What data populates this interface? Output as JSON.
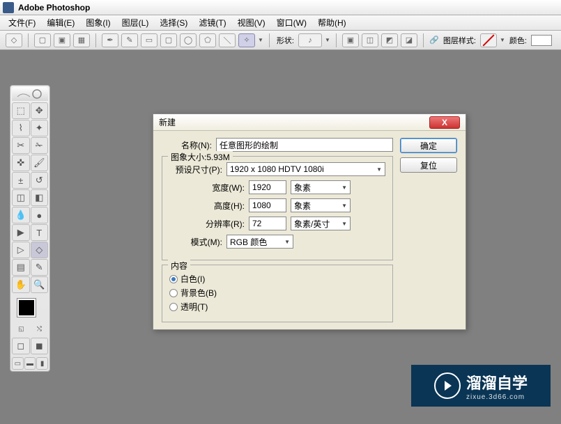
{
  "app": {
    "title": "Adobe Photoshop"
  },
  "menus": [
    "文件(F)",
    "编辑(E)",
    "图象(I)",
    "图层(L)",
    "选择(S)",
    "滤镜(T)",
    "视图(V)",
    "窗口(W)",
    "帮助(H)"
  ],
  "optionbar": {
    "shape_label": "形状:",
    "layer_style_label": "图层样式:",
    "color_label": "颜色:"
  },
  "dialog": {
    "title": "新建",
    "ok": "确定",
    "reset": "复位",
    "name_label": "名称(N):",
    "name_value": "任意图形的绘制",
    "image_size_label": "图象大小:5.93M",
    "preset_label": "预设尺寸(P):",
    "preset_value": "1920 x 1080 HDTV 1080i",
    "width_label": "宽度(W):",
    "width_value": "1920",
    "width_unit": "象素",
    "height_label": "高度(H):",
    "height_value": "1080",
    "height_unit": "象素",
    "resolution_label": "分辨率(R):",
    "resolution_value": "72",
    "resolution_unit": "象素/英寸",
    "mode_label": "模式(M):",
    "mode_value": "RGB 颜色",
    "content_label": "内容",
    "radio_white": "白色(I)",
    "radio_bgcolor": "背景色(B)",
    "radio_transparent": "透明(T)",
    "selected_content": "white"
  },
  "watermark": {
    "title": "溜溜自学",
    "url": "zixue.3d66.com"
  }
}
